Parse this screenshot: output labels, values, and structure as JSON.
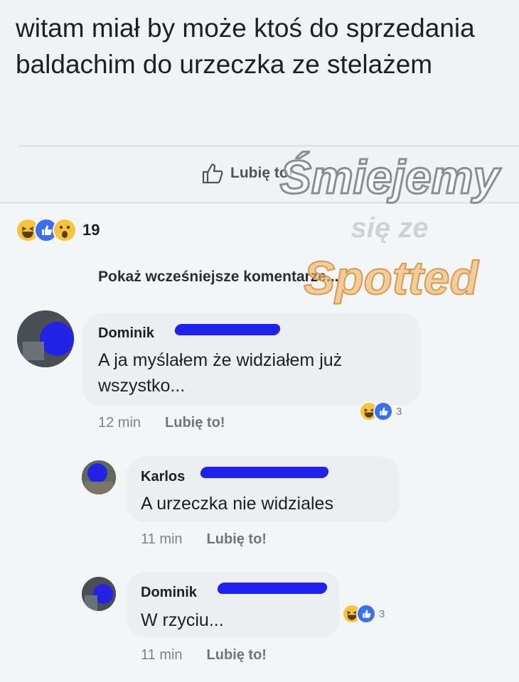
{
  "post": {
    "text": "witam miał by może ktoś do sprzedania baldachim do urzeczka ze stelażem",
    "like_action": "Lubię to!"
  },
  "reactions": {
    "types": [
      "haha",
      "like",
      "wow"
    ],
    "count": "19"
  },
  "show_more": "Pokaż wcześniejsze komentarze...",
  "comments": [
    {
      "author": "Dominik",
      "text": "A ja myślałem że widziałem już wszystko...",
      "time": "12 min",
      "like_label": "Lubię to!",
      "reaction_count": "3"
    },
    {
      "author": "Karlos",
      "text": "A urzeczka nie widziales",
      "time": "11 min",
      "like_label": "Lubię to!"
    },
    {
      "author": "Dominik",
      "text": "W rzyciu...",
      "time": "11 min",
      "like_label": "Lubię to!",
      "reaction_count": "3"
    }
  ],
  "watermark": {
    "line1": "Śmiejemy",
    "line2": "się ze",
    "line3": "Spotted"
  },
  "colors": {
    "like_blue": "#3a6ff2",
    "emoji_yellow": "#f6c43a",
    "scribble_blue": "#2020f0",
    "watermark_orange": "#f0b060"
  }
}
